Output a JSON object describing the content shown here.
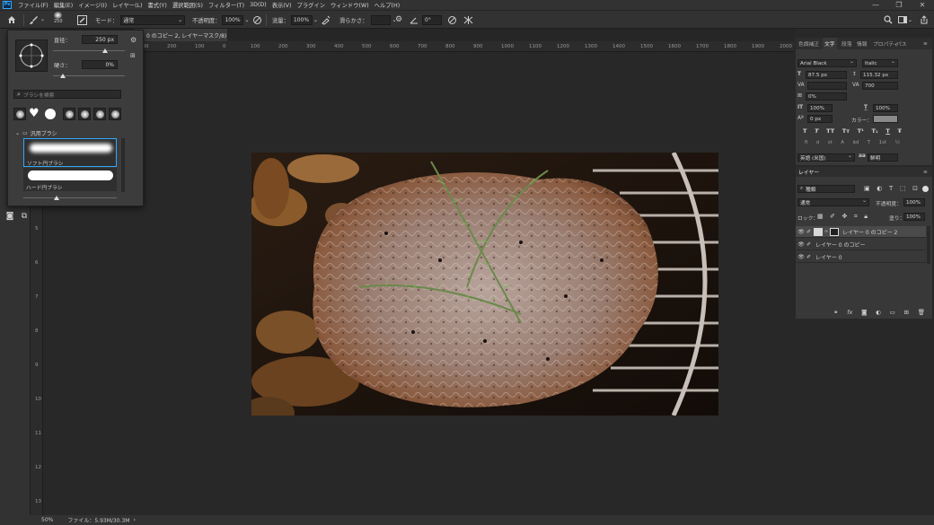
{
  "app": {
    "logo": "Ps"
  },
  "menu": [
    "ファイル(F)",
    "編集(E)",
    "イメージ(I)",
    "レイヤー(L)",
    "書式(Y)",
    "選択範囲(S)",
    "フィルター(T)",
    "3D(D)",
    "表示(V)",
    "プラグイン",
    "ウィンドウ(W)",
    "ヘルプ(H)"
  ],
  "window_controls": {
    "minimize": "—",
    "maximize": "❐",
    "close": "✕"
  },
  "options": {
    "brush_size": "250",
    "mode_label": "モード：",
    "mode_value": "通常",
    "opacity_label": "不透明度：",
    "opacity_value": "100%",
    "flow_label": "流量：",
    "flow_value": "100%",
    "smoothing_label": "滑らかさ：",
    "angle_value": "0°"
  },
  "document_tab": {
    "title": "0 のコピー 2, レイヤーマスク/8) *",
    "close": "×"
  },
  "ruler": {
    "h_labels": [
      "400",
      "300",
      "200",
      "100",
      "0",
      "100",
      "200",
      "300",
      "400",
      "500",
      "600",
      "700",
      "800",
      "900",
      "1000",
      "1100",
      "1200",
      "1300",
      "1400",
      "1500",
      "1600",
      "1700",
      "1800",
      "1900",
      "2000",
      "2100",
      "2200"
    ],
    "v_labels": [
      "0",
      "1",
      "2",
      "3",
      "4",
      "5",
      "6",
      "7",
      "8",
      "9",
      "10",
      "11",
      "12",
      "13"
    ]
  },
  "brush_popup": {
    "size_label": "直径：",
    "size_value": "250 px",
    "hardness_label": "硬さ：",
    "hardness_value": "0%",
    "search_placeholder": "ブラシを検索",
    "folder_label": "汎用ブラシ",
    "brush1_label": "ソフト円ブラシ",
    "brush2_label": "ハード円ブラシ",
    "size_fraction": 0.72,
    "hardness_fraction": 0.0
  },
  "right_tabs": [
    "色調補正",
    "文字",
    "段落",
    "情報",
    "プロパティ",
    "パス"
  ],
  "character": {
    "font_family": "Arial Black",
    "font_style": "Italic",
    "font_size": "87.5 px",
    "leading": "115.32 px",
    "kerning": "",
    "tracking": "700",
    "tsume": "0%",
    "vscale": "100%",
    "hscale": "100%",
    "baseline": "0 px",
    "color_label": "カラー：",
    "language": "英語 (米国)",
    "aa_label": "aa",
    "aa_value": "鮮明",
    "style_glyphs": [
      "T",
      "T",
      "TT",
      "Tт",
      "T¹",
      "T₁",
      "T",
      "Ŧ"
    ],
    "opentype_glyphs": [
      "fi",
      "ơ",
      "st",
      "A",
      "ād",
      "T",
      "1st",
      "½"
    ]
  },
  "layers": {
    "tab": "レイヤー",
    "filter_label": "種類",
    "blend_mode": "通常",
    "opacity_label": "不透明度：",
    "opacity_value": "100%",
    "lock_label": "ロック：",
    "fill_label": "塗り：",
    "fill_value": "100%",
    "items": [
      {
        "name": "レイヤー 0 のコピー 2",
        "selected": true,
        "has_mask": true
      },
      {
        "name": "レイヤー 0 のコピー",
        "selected": false,
        "has_mask": false
      },
      {
        "name": "レイヤー 0",
        "selected": false,
        "has_mask": false
      }
    ],
    "footer_icons": [
      "link-icon",
      "fx-icon",
      "mask-icon",
      "adjustment-icon",
      "folder-icon",
      "new-layer-icon",
      "trash-icon"
    ]
  },
  "status": {
    "zoom": "50%",
    "file_info": "ファイル：5.93M/30.3M",
    "arrow": "›"
  },
  "colors": {
    "accent": "#31a8ff",
    "panel": "#383838",
    "bg": "#282828"
  }
}
